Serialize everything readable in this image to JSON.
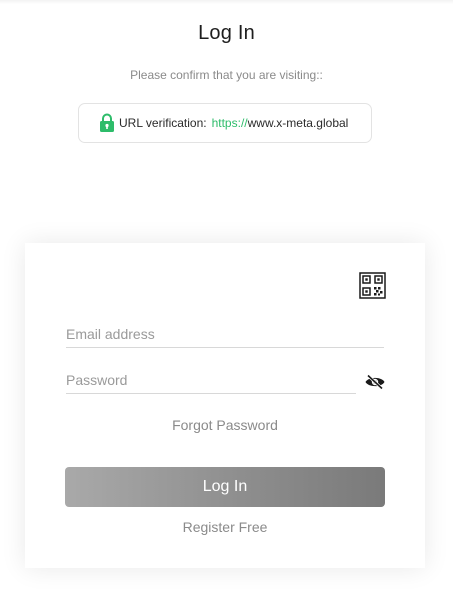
{
  "header": {
    "title": "Log In",
    "confirm_text": "Please confirm that you are visiting::"
  },
  "url_verification": {
    "label": "URL verification:",
    "scheme": "https://",
    "host": "www.x-meta.global",
    "lock_icon": "lock-icon",
    "accent_color": "#2dbc6a"
  },
  "form": {
    "qr_icon": "qr-code-icon",
    "email_placeholder": "Email address",
    "email_value": "",
    "password_placeholder": "Password",
    "password_value": "",
    "visibility_icon": "eye-off-icon",
    "forgot_label": "Forgot Password",
    "login_label": "Log In",
    "register_label": "Register Free"
  }
}
